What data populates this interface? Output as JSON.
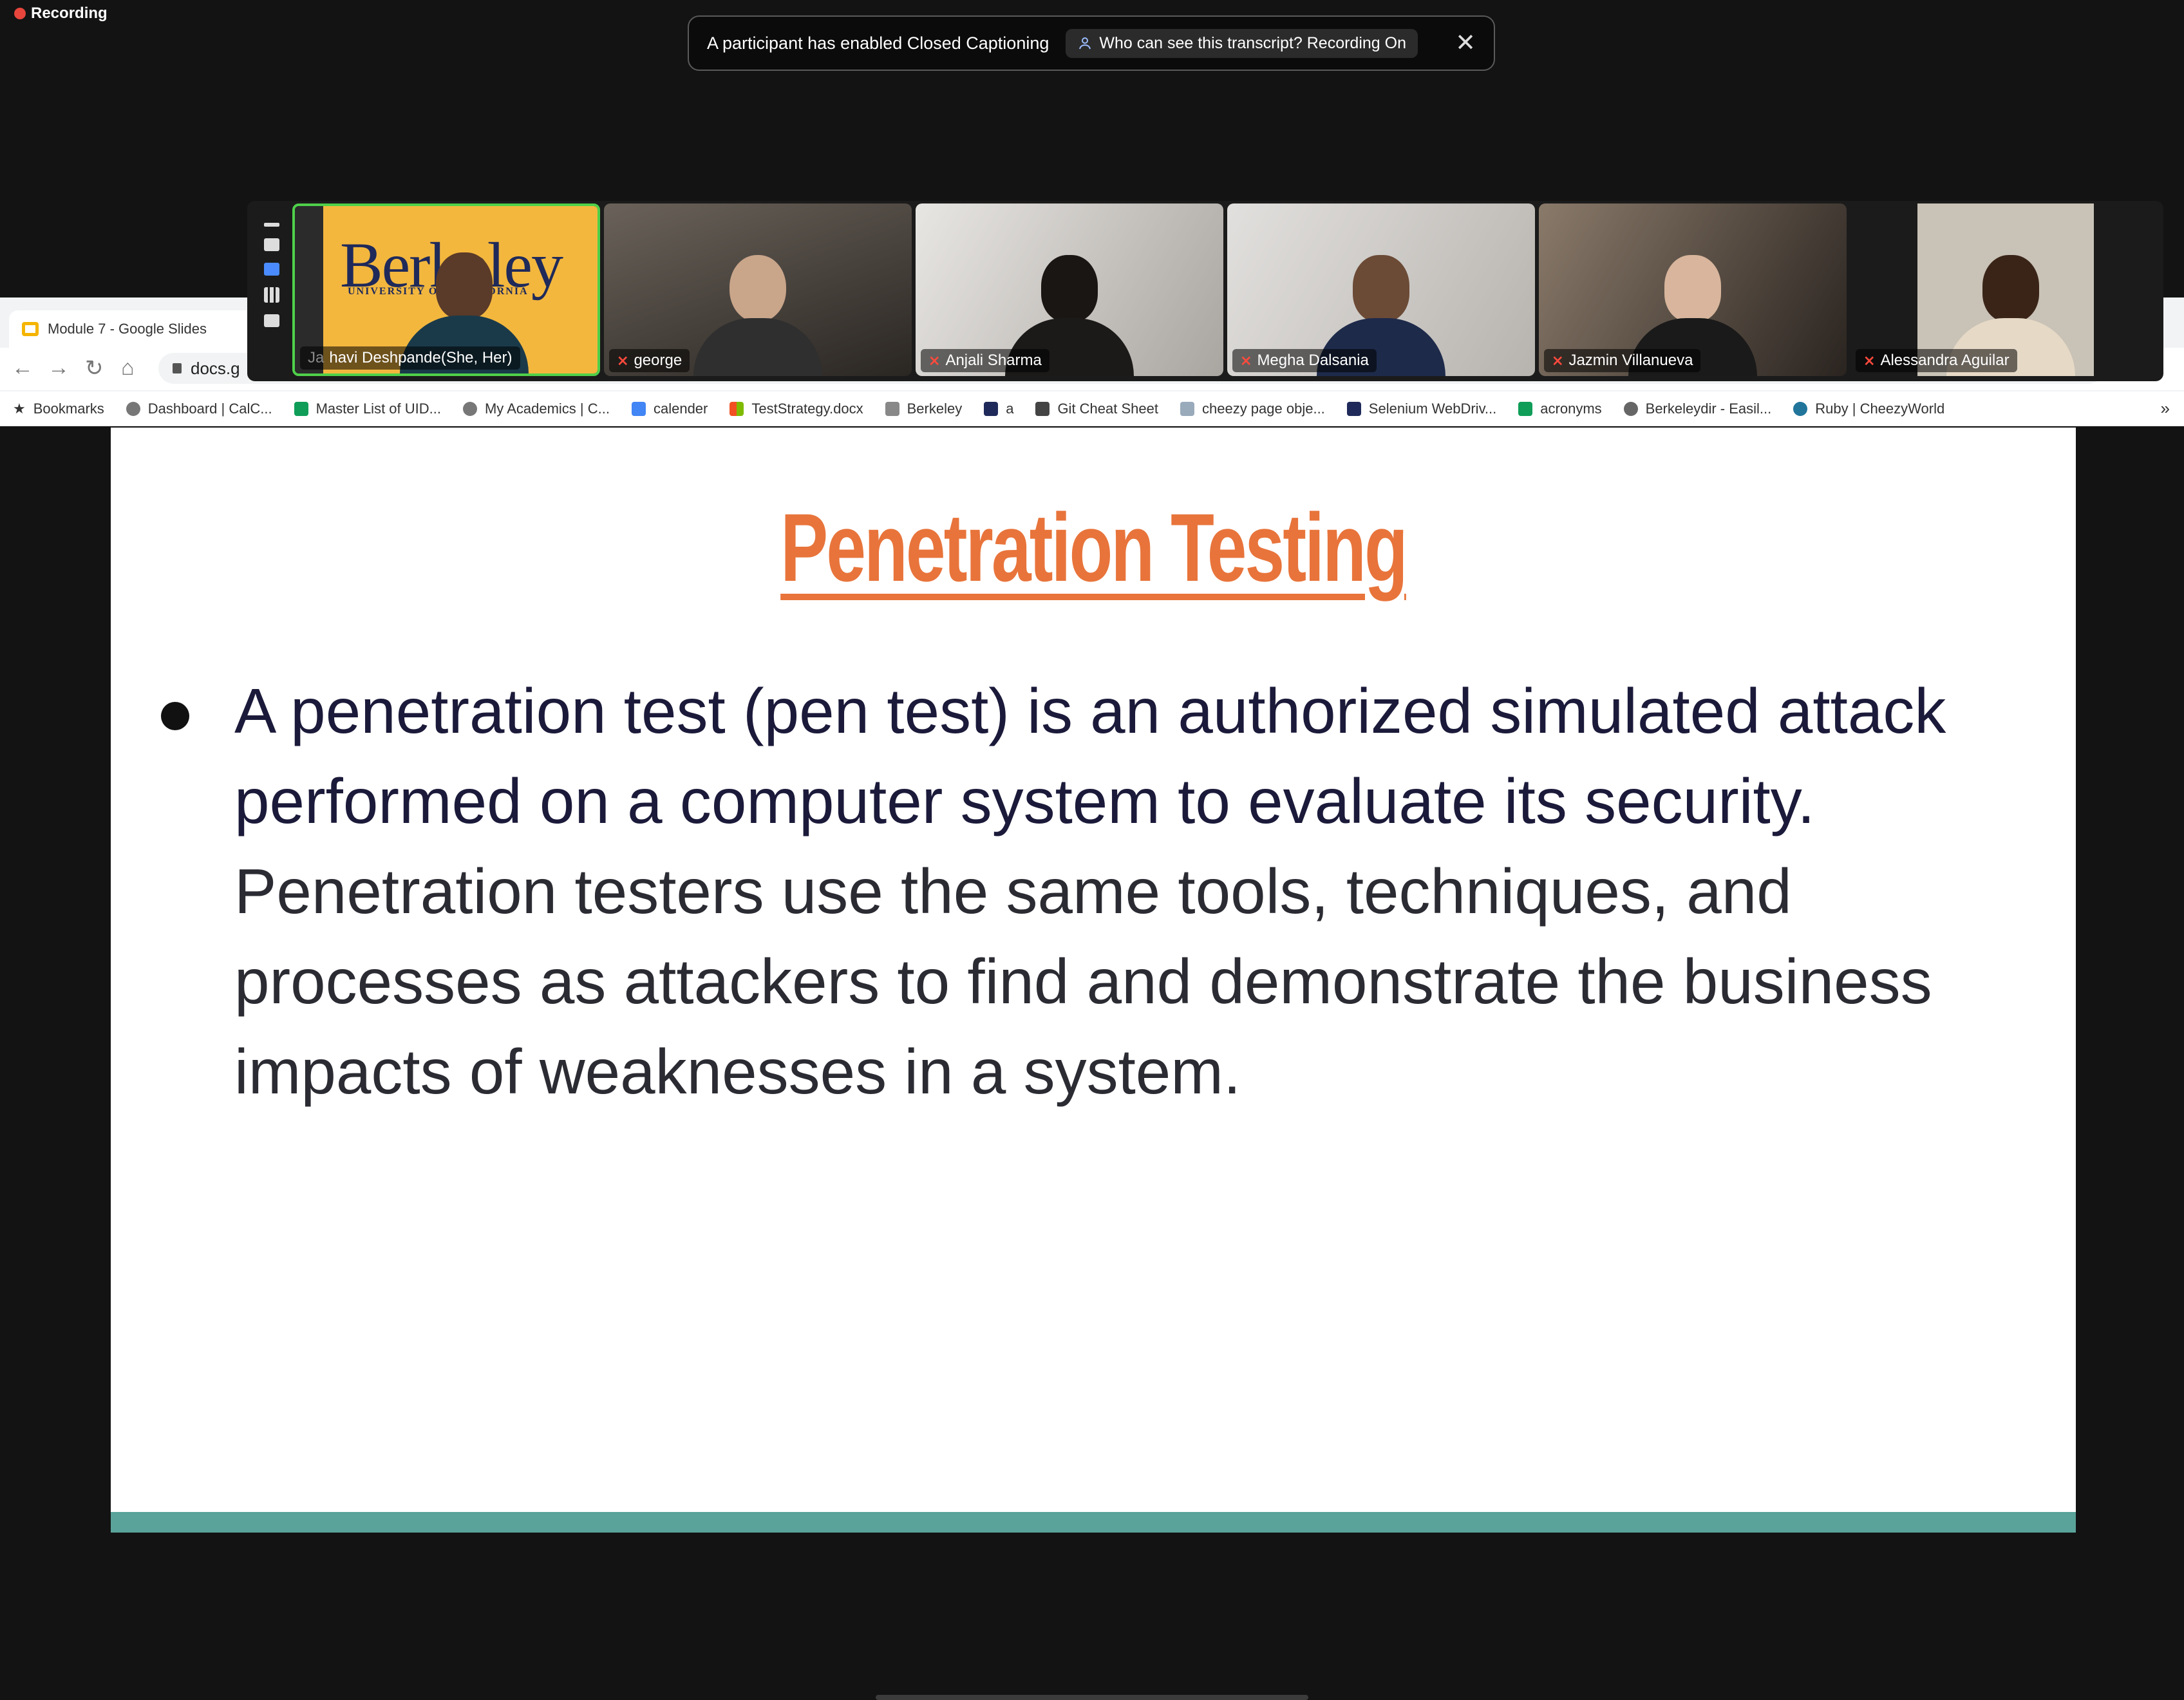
{
  "recording": {
    "label": "Recording"
  },
  "cc_banner": {
    "message": "A participant has enabled Closed Captioning",
    "who_can_see": "Who can see this transcript? Recording On",
    "close_icon": "close-icon"
  },
  "browser": {
    "tab_title": "Module 7 - Google Slides",
    "url": "docs.g",
    "bookmarks": [
      "Bookmarks",
      "Dashboard | CalC...",
      "Master List of UID...",
      "My Academics | C...",
      "calender",
      "TestStrategy.docx",
      "Berkeley",
      "a",
      "Git Cheat Sheet",
      "cheezy page obje...",
      "Selenium WebDriv...",
      "acronyms",
      "Berkeleydir - Easil...",
      "Ruby | CheezyWorld"
    ],
    "more": "»"
  },
  "participants": [
    {
      "name_prefix": "Ja",
      "name": "havi Deshpande(She, Her)",
      "muted": false,
      "active": true,
      "bg": "#f3b73e"
    },
    {
      "name": "george",
      "muted": true,
      "bg": "#3a3631"
    },
    {
      "name": "Anjali Sharma",
      "muted": true,
      "bg": "#b9b5b1"
    },
    {
      "name": "Megha Dalsania",
      "muted": true,
      "bg": "#c9c6c3"
    },
    {
      "name": "Jazmin Villanueva",
      "muted": true,
      "bg": "#5a5047"
    },
    {
      "name": "Alessandra Aguilar",
      "muted": true,
      "bg": "#8a8276"
    }
  ],
  "berkeley_logo": {
    "word": "Berkeley",
    "sub": "UNIVERSITY OF CALIFORNIA"
  },
  "slide": {
    "title": "Penetration Testing",
    "bullet_part1": "A penetration test (pen test) is an authorized simulated attack performed on a computer system to evaluate its security.",
    "bullet_part2": " Penetration testers use the same tools, techniques, and processes as attackers to find and demonstrate the business impacts of weaknesses in a system."
  },
  "colors": {
    "title": "#e8743b",
    "footer_bar": "#5aa39a",
    "active_speaker": "#4fd04a"
  }
}
